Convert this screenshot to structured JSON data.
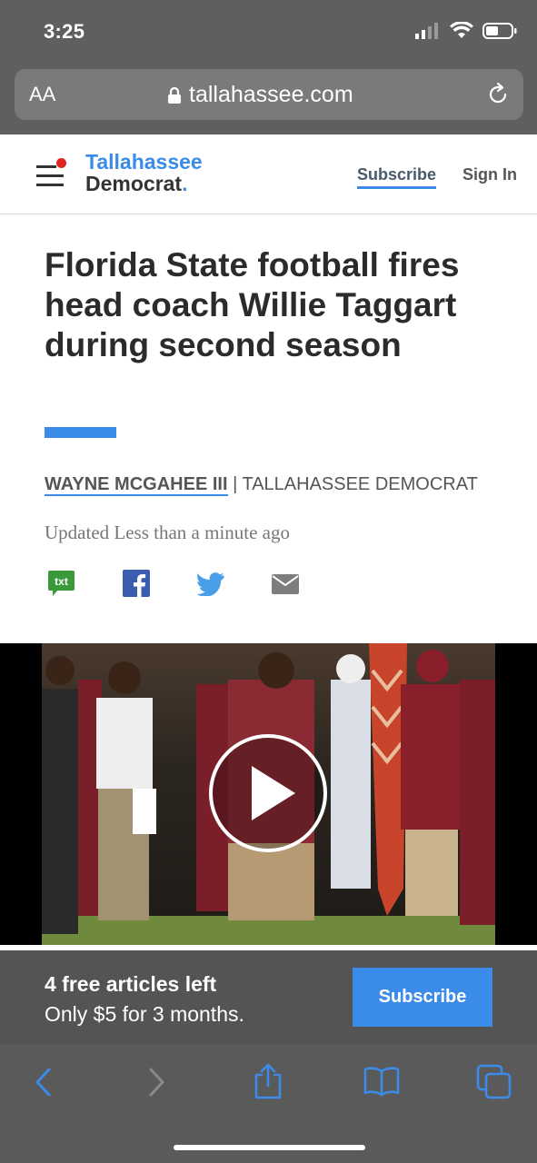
{
  "status_bar": {
    "time": "3:25"
  },
  "browser": {
    "text_size_label": "AA",
    "url": "tallahassee.com"
  },
  "site": {
    "logo_line1": "Tallahassee",
    "logo_line2": "Democrat",
    "logo_period": ".",
    "subscribe": "Subscribe",
    "sign_in": "Sign In",
    "accent_color": "#3b8be8"
  },
  "article": {
    "headline": "Florida State football fires head coach Willie Taggart during second season",
    "author": "Wayne McGahee III",
    "separator": " | ",
    "publication": "Tallahassee Democrat",
    "updated": "Updated Less than a minute ago",
    "share_icons": [
      "txt-icon",
      "facebook-icon",
      "twitter-icon",
      "email-icon"
    ],
    "txt_label": "txt"
  },
  "video": {
    "play_icon": "play-icon"
  },
  "paywall": {
    "title": "4 free articles left",
    "subtitle": "Only $5 for 3 months.",
    "button": "Subscribe"
  },
  "toolbar": {
    "icons": [
      "back-icon",
      "forward-icon",
      "share-icon",
      "bookmarks-icon",
      "tabs-icon"
    ]
  }
}
